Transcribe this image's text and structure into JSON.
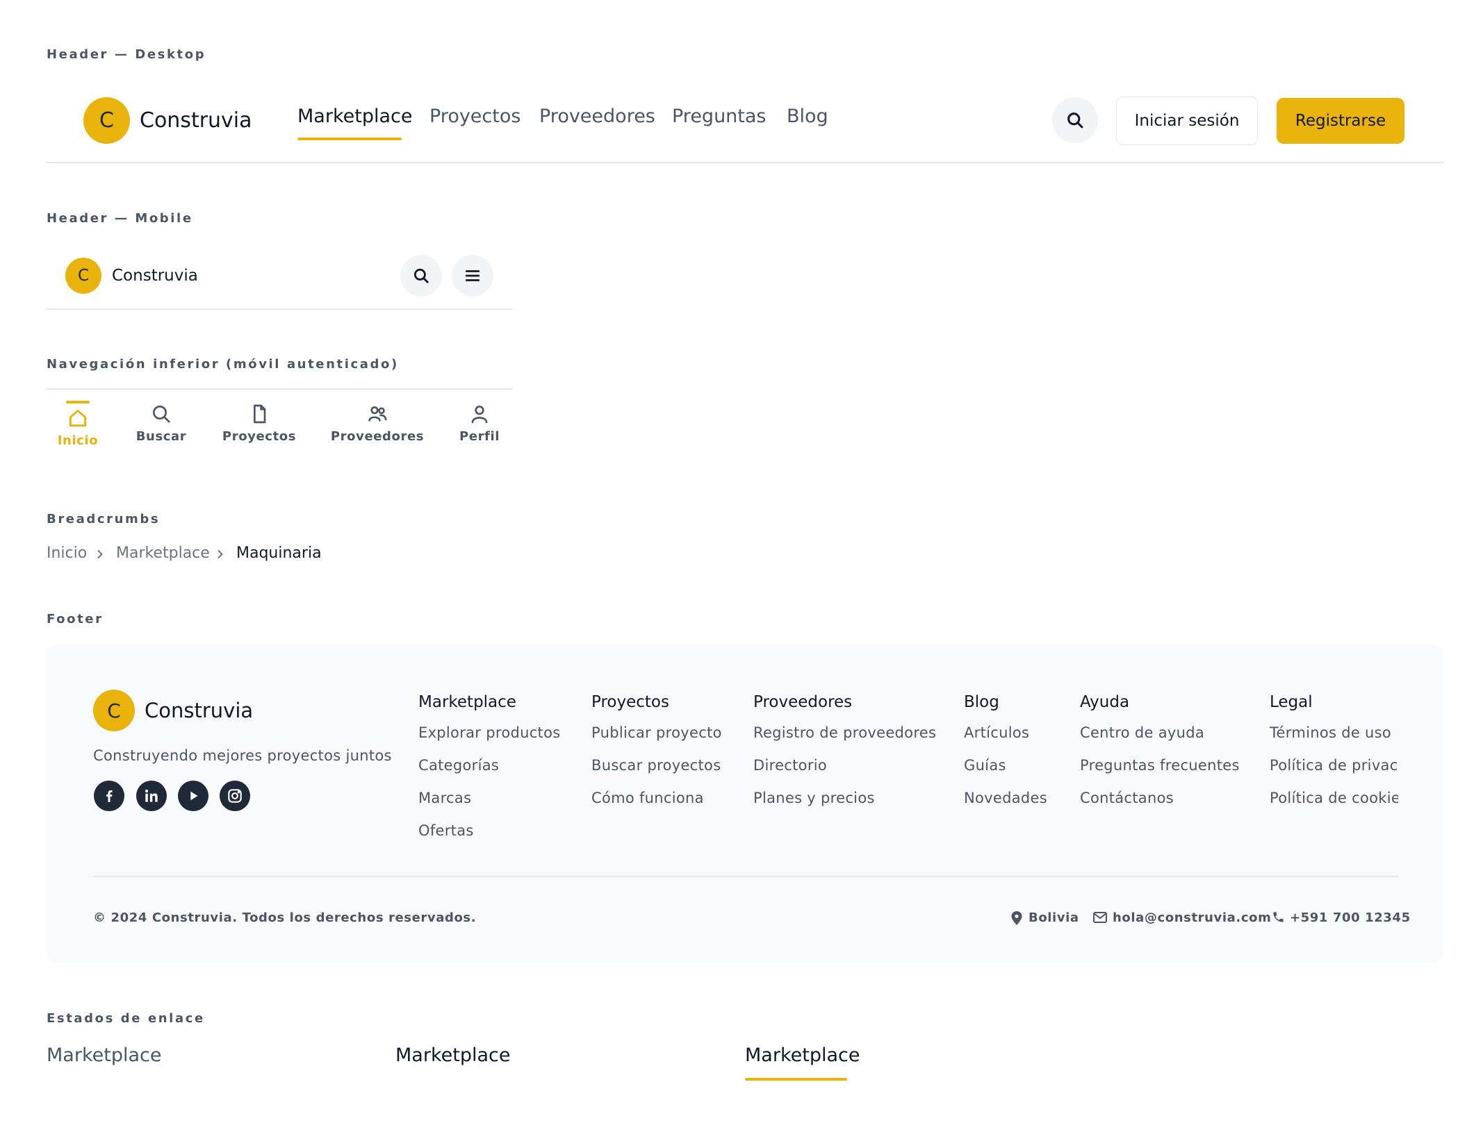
{
  "brand": {
    "name": "Construvia",
    "initial": "C",
    "accent": "#e9b30c"
  },
  "sections": {
    "desktop": "Header — Desktop",
    "mobile": "Header — Mobile",
    "bottom_nav": "Navegación inferior (móvil autenticado)",
    "breadcrumbs": "Breadcrumbs",
    "footer": "Footer",
    "link_states": "Estados de enlace"
  },
  "desktop_header": {
    "nav": [
      {
        "label": "Marketplace",
        "active": true
      },
      {
        "label": "Proyectos"
      },
      {
        "label": "Proveedores"
      },
      {
        "label": "Preguntas"
      },
      {
        "label": "Blog"
      }
    ],
    "search_icon": "search-icon",
    "login_label": "Iniciar sesión",
    "register_label": "Registrarse"
  },
  "mobile_header": {
    "search_icon": "search-icon",
    "menu_icon": "hamburger-icon"
  },
  "bottom_nav": {
    "items": [
      {
        "label": "Inicio",
        "icon": "home-icon",
        "active": true
      },
      {
        "label": "Buscar",
        "icon": "search-icon"
      },
      {
        "label": "Proyectos",
        "icon": "document-icon"
      },
      {
        "label": "Proveedores",
        "icon": "users-icon"
      },
      {
        "label": "Perfil",
        "icon": "user-icon"
      }
    ]
  },
  "breadcrumbs": {
    "items": [
      "Inicio",
      "Marketplace",
      "Maquinaria"
    ],
    "separator_icon": "chevron-right-icon"
  },
  "footer": {
    "tagline": "Construyendo mejores proyectos juntos",
    "social": [
      "facebook-icon",
      "linkedin-icon",
      "youtube-icon",
      "instagram-icon"
    ],
    "columns": [
      {
        "title": "Marketplace",
        "links": [
          "Explorar productos",
          "Categorías",
          "Marcas",
          "Ofertas"
        ]
      },
      {
        "title": "Proyectos",
        "links": [
          "Publicar proyecto",
          "Buscar proyectos",
          "Cómo funciona"
        ]
      },
      {
        "title": "Proveedores",
        "links": [
          "Registro de proveedores",
          "Directorio",
          "Planes y precios"
        ]
      },
      {
        "title": "Blog",
        "links": [
          "Artículos",
          "Guías",
          "Novedades"
        ]
      },
      {
        "title": "Ayuda",
        "links": [
          "Centro de ayuda",
          "Preguntas frecuentes",
          "Contáctanos"
        ]
      },
      {
        "title": "Legal",
        "links": [
          "Términos de uso",
          "Política de privaci",
          "Política de cookie:"
        ]
      }
    ],
    "copyright": "© 2024 Construvia. Todos los derechos reservados.",
    "location": "Bolivia",
    "email": "hola@construvia.com",
    "phone": "+591 700 12345"
  },
  "link_states": {
    "default": "Marketplace",
    "hover": "Marketplace",
    "active": "Marketplace"
  }
}
